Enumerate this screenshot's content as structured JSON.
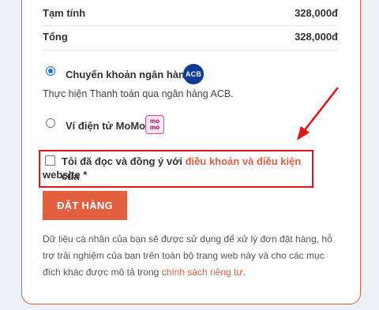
{
  "summary": {
    "subtotal_label": "Tạm tính",
    "subtotal_value": "328,000đ",
    "total_label": "Tổng",
    "total_value": "328,000đ"
  },
  "payment": {
    "bank_label": "Chuyển khoản ngân hàng",
    "bank_logo": "ACB",
    "bank_description": "Thực hiện Thanh toán qua ngân hàng ACB.",
    "momo_label": "Ví điện tử MoMo",
    "momo_logo_line1": "mo",
    "momo_logo_line2": "mo"
  },
  "terms": {
    "prefix": "Tôi đã đọc và đồng ý với ",
    "link": "điều khoản và điều kiện",
    "suffix": " của",
    "line2": "website *"
  },
  "order_button": "ĐẶT HÀNG",
  "privacy": {
    "text": "Dữ liệu cá nhân của bạn sẽ được sử dụng để xử lý đơn đặt hàng, hỗ trợ trải nghiệm của bạn trên toàn bộ trang web này và cho các mục đích khác được mô tả trong ",
    "link": "chính sách riêng tư",
    "end": "."
  },
  "colors": {
    "accent": "#e2603f",
    "highlight": "#e0161b",
    "radio": "#1a73e8"
  }
}
